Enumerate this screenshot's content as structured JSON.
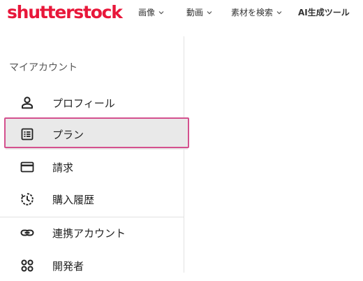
{
  "brand": {
    "logo_text": "shutterstock",
    "color": "#e8173a"
  },
  "header": {
    "nav": [
      {
        "label": "画像",
        "has_dropdown": true
      },
      {
        "label": "動画",
        "has_dropdown": true
      },
      {
        "label": "素材を検索",
        "has_dropdown": true
      },
      {
        "label": "AI生成ツール",
        "has_dropdown": false
      }
    ]
  },
  "sidebar": {
    "section_title": "マイアカウント",
    "items": [
      {
        "label": "プロフィール",
        "icon": "person-icon",
        "selected": false
      },
      {
        "label": "プラン",
        "icon": "list-icon",
        "selected": true
      },
      {
        "label": "請求",
        "icon": "credit-card-icon",
        "selected": false
      },
      {
        "label": "購入履歴",
        "icon": "history-icon",
        "selected": false
      },
      {
        "label": "連携アカウント",
        "icon": "link-icon",
        "selected": false
      },
      {
        "label": "開発者",
        "icon": "apps-icon",
        "selected": false
      }
    ],
    "highlight_color": "#d4518e"
  }
}
